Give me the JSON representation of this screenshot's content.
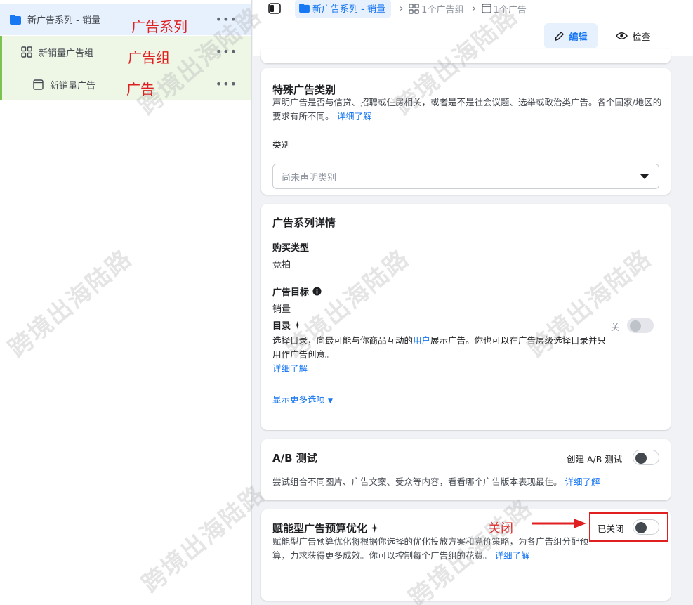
{
  "tree": {
    "campaign": {
      "label": "新广告系列 - 销量",
      "tag": "广告系列"
    },
    "adset": {
      "label": "新销量广告组",
      "tag": "广告组"
    },
    "ad": {
      "label": "新销量广告",
      "tag": "广告"
    },
    "more": "•••"
  },
  "breadcrumb": {
    "campaign": "新广告系列 - 销量",
    "adsets": "1个广告组",
    "ads": "1个广告"
  },
  "toolbar": {
    "edit": "编辑",
    "view": "检查"
  },
  "special_category": {
    "title": "特殊广告类别",
    "desc": "声明广告是否与信贷、招聘或住房相关，或者是不是社会议题、选举或政治类广告。各个国家/地区的要求有所不同。",
    "link": "详细了解",
    "category_label": "类别",
    "category_placeholder": "尚未声明类别"
  },
  "details": {
    "title": "广告系列详情",
    "buy_type_label": "购买类型",
    "buy_type_value": "竞拍",
    "objective_label": "广告目标",
    "objective_value": "销量",
    "catalog_label": "目录",
    "catalog_toggle_label": "关",
    "catalog_desc_1": "选择目录，向最可能与你商品互动的",
    "catalog_desc_link": "用户",
    "catalog_desc_2": "展示广告。你也可以在广告层级选择目录并只用作广告创意。",
    "catalog_link": "详细了解",
    "more_options": "显示更多选项"
  },
  "ab_test": {
    "title": "A/B 测试",
    "toggle_label": "创建 A/B 测试",
    "desc": "尝试组合不同图片、广告文案、受众等内容，看看哪个广告版本表现最佳。",
    "link": "详细了解"
  },
  "budget": {
    "title": "赋能型广告预算优化",
    "toggle_label": "已关闭",
    "desc": "赋能型广告预算优化将根据你选择的优化投放方案和竞价策略，为各广告组分配预算，力求获得更多成效。你可以控制每个广告组的花费。",
    "link": "详细了解",
    "annotation": "关闭"
  },
  "watermark": "跨境出海陆路",
  "colors": {
    "accent": "#1877f2",
    "annotation": "#e02020",
    "selected_bg": "#e7f0fd",
    "child_bg": "#eef6e6"
  }
}
